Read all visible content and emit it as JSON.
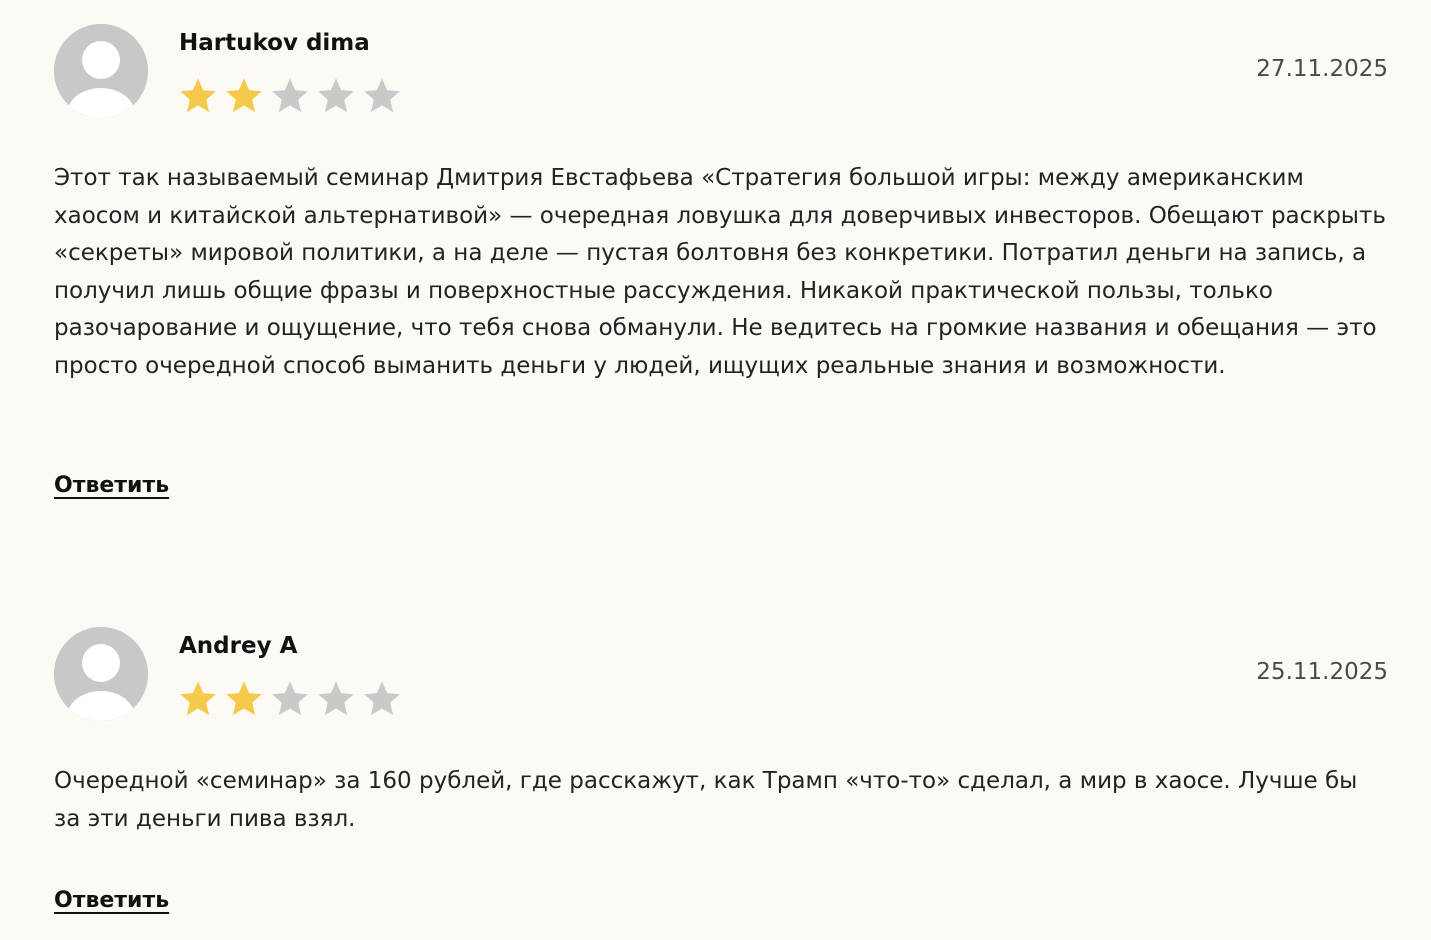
{
  "colors": {
    "star_filled": "#f5c94a",
    "star_empty": "#c9c9c9",
    "avatar_bg": "#c8c8c8",
    "page_bg": "#fdfaf6"
  },
  "reviews": [
    {
      "author": "Hartukov dima",
      "date": "27.11.2025",
      "rating": 2,
      "max_rating": 5,
      "text": "Этот так называемый семинар Дмитрия Евстафьева «Стратегия большой игры: между американским хаосом и китайской альтернативой» — очередная ловушка для доверчивых инвесторов. Обещают раскрыть «секреты» мировой политики, а на деле — пустая болтовня без конкретики. Потратил деньги на запись, а получил лишь общие фразы и поверхностные рассуждения. Никакой практической пользы, только разочарование и ощущение, что тебя снова обманули. Не ведитесь на громкие названия и обещания — это просто очередной способ выманить деньги у людей, ищущих реальные знания и возможности.",
      "reply_label": "Ответить",
      "avatar_icon": "user-avatar-icon"
    },
    {
      "author": "Andrey A",
      "date": "25.11.2025",
      "rating": 2,
      "max_rating": 5,
      "text": "Очередной «семинар» за 160 рублей, где расскажут, как Трамп «что-то» сделал, а мир в хаосе. Лучше бы за эти деньги пива взял.",
      "reply_label": "Ответить",
      "avatar_icon": "user-avatar-icon"
    }
  ]
}
